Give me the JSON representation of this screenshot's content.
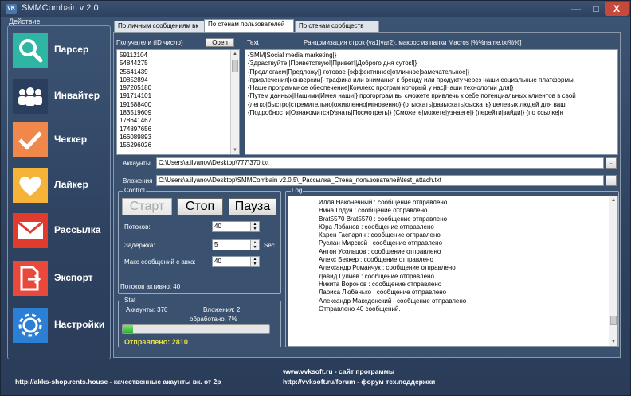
{
  "window": {
    "title": "SMMCombain v 2.0",
    "icon_text": "VK",
    "min_label": "—",
    "max_label": "□",
    "close_label": "X"
  },
  "sidebar": {
    "group_label": "Действие",
    "items": [
      {
        "label": "Парсер",
        "icon": "search-icon",
        "color": "#2fb5a3"
      },
      {
        "label": "Инвайтер",
        "icon": "users-icon",
        "color": "#2a3f5d"
      },
      {
        "label": "Чеккер",
        "icon": "checkmark-icon",
        "color": "#f0884c"
      },
      {
        "label": "Лайкер",
        "icon": "heart-icon",
        "color": "#f6b33a"
      },
      {
        "label": "Рассылка",
        "icon": "envelope-icon",
        "color": "#e23b2e"
      },
      {
        "label": "Экспорт",
        "icon": "export-icon",
        "color": "#e8493b"
      },
      {
        "label": "Настройки",
        "icon": "gear-icon",
        "color": "#2b7fd4"
      }
    ]
  },
  "tabs": [
    {
      "label": "По личным сообщениям вк",
      "active": false
    },
    {
      "label": "По стенам пользователей",
      "active": true
    },
    {
      "label": "По стенам сообществ",
      "active": false
    }
  ],
  "recipients": {
    "label": "Получатели (ID число)",
    "open_label": "Open",
    "ids": [
      "59112104",
      "54844275",
      "25641439",
      "10852894",
      "197205180",
      "191714101",
      "191588400",
      "183519609",
      "178641467",
      "174897656",
      "166089893",
      "156296026"
    ]
  },
  "text_section": {
    "label": "Text",
    "hint": "Рандомизация строк {va1|var2}, макрос из папки Macros [%%name.txt%%]",
    "lines": [
      "{SMM|Social media marketing|}",
      "{Здраствуйте!|Приветствую!|Привет!|Доброго дня суток!|}",
      "{Предлогаем|Предложу|} готовое {эффективное|отличное|замечательное|}",
      "{привлечения|конверсии|} трафика или внимания к бренду или продукту через наши социальные платформы",
      "{Наше программное обеспечение|Комлекс програм который у нас|Наши технологии для|}",
      "{Путем данных|Нашими|Имея наши|} прогорграм вы сможете привлечь к себе потенциальных клиентов в свой",
      "{легко|быстро|стремительно|оживленно|мгновенно} {отыскать|разыскать|сыскать} целевых людей для ваш",
      "{Подробности|Ознакомится|Узнать|Посмотреть|} {Сможете|можете|узнаете|} {перейти|зайди|} {по ссылке|н"
    ]
  },
  "accounts": {
    "label": "Аккаунты",
    "value": "C:\\Users\\a.ilyanov\\Desktop\\777\\370.txt",
    "browse": "..."
  },
  "attachments": {
    "label": "Вложения",
    "value": "C:\\Users\\a.ilyanov\\Desktop\\SMMCombain v2.0.5\\_Рассылка_Стена_пользователей\\test_attach.txt",
    "browse": "..."
  },
  "control": {
    "group_label": "Control",
    "start": "Старт",
    "stop": "Стоп",
    "pause": "Пауза",
    "threads_label": "Потоков:",
    "threads_value": "40",
    "delay_label": "Задержка:",
    "delay_value": "5",
    "delay_unit": "Sec",
    "max_label": "Макс сообщений с акка:",
    "max_value": "40",
    "active_label": "Потоков активно: 40"
  },
  "stat": {
    "group_label": "Stat",
    "accounts": "Аккаунты: 370",
    "attachments": "Вложения: 2",
    "processed": "обработано: 7%",
    "progress_fraction": 0.07,
    "sent": "Отправлено: 2810"
  },
  "log": {
    "group_label": "Log",
    "lines": [
      "Илля Наконечный : сообщение отправлено",
      "Нина Годун : сообщение отправлено",
      "Brat5570 Brat5570 : сообщение отправлено",
      "Юра Лобанов : сообщение отправлено",
      "Карен Гаспарян : сообщение отправлено",
      "Руслан Мирской : сообщение отправлено",
      "Антон Усольцов : сообщение отправлено",
      "Алекс Беккер : сообщение отправлено",
      "Александр Романчук : сообщение отправлено",
      "Давид Гулиев : сообщение отправлено",
      "Никита Воронов : сообщение отправлено",
      "Лариса Любенько : сообщение отправлено",
      "Александр Македонский : сообщение отправлено",
      "Отправлено 40 сообщений."
    ]
  },
  "footer": {
    "left": "http://akks-shop.rents.house - качественные акаунты вк. от 2р",
    "right_top": "www.vvksoft.ru - сайт программы",
    "right_bottom": "http://vvksoft.ru/forum - форум тех.поддержки"
  }
}
